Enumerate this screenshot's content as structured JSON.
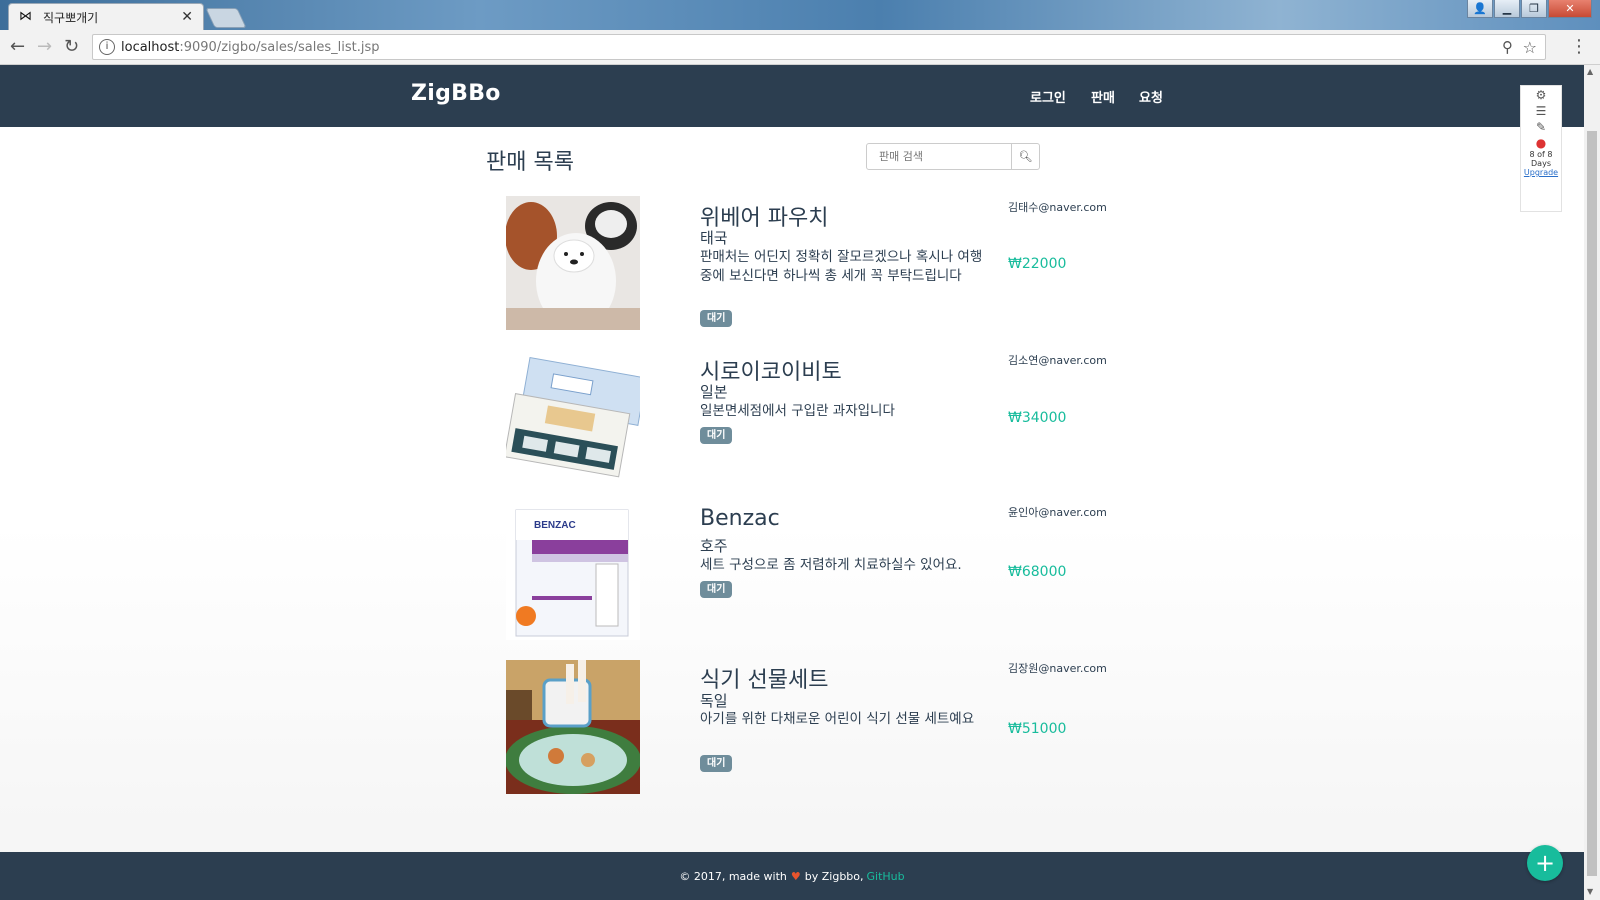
{
  "browser": {
    "tab_title": "직구뽀개기",
    "tab_close": "✕",
    "url_host": "localhost",
    "url_path": ":9090/zigbo/sales/sales_list.jsp"
  },
  "site": {
    "brand": "ZigBBo",
    "nav": [
      "로그인",
      "판매",
      "요청"
    ]
  },
  "page": {
    "heading": "판매 목록",
    "search_placeholder": "판매 검색"
  },
  "items": [
    {
      "title": "위베어 파우치",
      "country": "태국",
      "description": "판매처는 어딘지 정확히 잘모르겠으나 혹시나 여행중에 보신다면 하나씩 총 세개 꼭 부탁드립니다",
      "status": "대기",
      "email": "김태수@naver.com",
      "price": "₩22000"
    },
    {
      "title": "시로이코이비토",
      "country": "일본",
      "description": "일본면세점에서 구입란 과자입니다",
      "status": "대기",
      "email": "김소연@naver.com",
      "price": "₩34000"
    },
    {
      "title": "Benzac",
      "country": "호주",
      "description": "세트 구성으로 좀 저렴하게 치료하실수 있어요.",
      "status": "대기",
      "email": "윤인아@naver.com",
      "price": "₩68000"
    },
    {
      "title": "식기 선물세트",
      "country": "독일",
      "description": "아기를 위한 다채로운 어린이 식기 선물 세트예요",
      "status": "대기",
      "email": "김장원@naver.com",
      "price": "₩51000"
    }
  ],
  "extension": {
    "count": "8 of 8",
    "unit": "Days",
    "upgrade": "Upgrade"
  },
  "footer": {
    "prefix": "© 2017, made with",
    "middle": "by Zigbbo,",
    "link": "GitHub"
  },
  "fab_label": "+"
}
